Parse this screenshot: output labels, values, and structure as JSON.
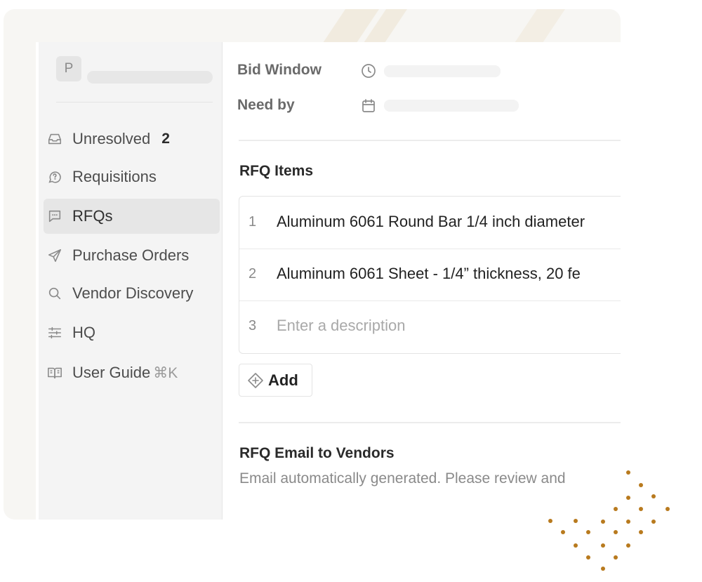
{
  "sidebar": {
    "workspace_initial": "P",
    "items": [
      {
        "label": "Unresolved",
        "count": "2",
        "icon": "inbox-icon"
      },
      {
        "label": "Requisitions",
        "icon": "chat-question-icon"
      },
      {
        "label": "RFQs",
        "icon": "message-square-icon",
        "active": true
      },
      {
        "label": "Purchase Orders",
        "icon": "send-icon"
      },
      {
        "label": "Vendor Discovery",
        "icon": "search-icon"
      },
      {
        "label": "HQ",
        "icon": "sliders-icon"
      },
      {
        "label": "User Guide",
        "shortcut": "⌘K",
        "icon": "book-icon"
      }
    ]
  },
  "rfq": {
    "bid_window_label": "Bid Window",
    "need_by_label": "Need by",
    "items_title": "RFQ Items",
    "items": [
      {
        "num": "1",
        "description": "Aluminum 6061 Round Bar 1/4 inch diameter"
      },
      {
        "num": "2",
        "description": "Aluminum 6061 Sheet - 1/4” thickness, 20 fe"
      },
      {
        "num": "3",
        "placeholder": "Enter a description"
      }
    ],
    "add_label": "Add",
    "email_title": "RFQ Email to Vendors",
    "email_description": "Email automatically generated. Please review and"
  },
  "colors": {
    "frame_bg": "#f7f6f3",
    "sidebar_bg": "#f4f4f4",
    "active_nav_bg": "#e6e6e6",
    "decor_dots": "#b87a1e"
  }
}
